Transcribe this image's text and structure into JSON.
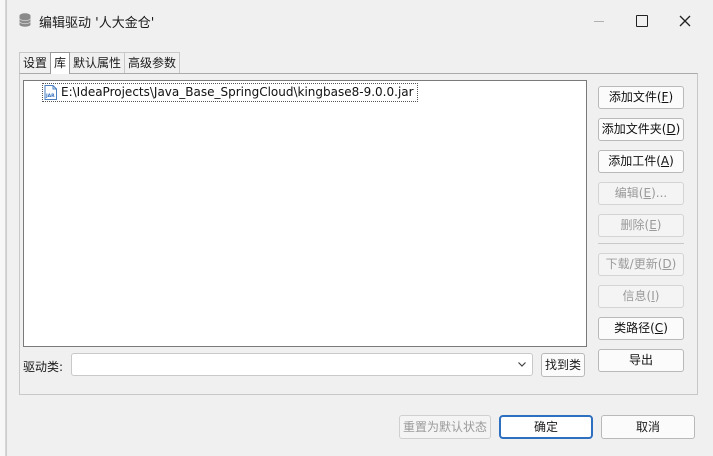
{
  "window": {
    "title": "编辑驱动 '人大金仓'"
  },
  "tabs": [
    {
      "label": "设置"
    },
    {
      "label": "库"
    },
    {
      "label": "默认属性"
    },
    {
      "label": "高级参数"
    }
  ],
  "libraries": {
    "items": [
      {
        "path": "E:\\IdeaProjects\\Java_Base_SpringCloud\\kingbase8-9.0.0.jar",
        "icon": "jar-icon"
      }
    ]
  },
  "side_buttons": {
    "add_file": {
      "label": "添加文件(",
      "mnemonic": "F",
      "suffix": ")"
    },
    "add_folder": {
      "label": "添加文件夹(",
      "mnemonic": "D",
      "suffix": ")"
    },
    "add_artifact": {
      "label": "添加工件(",
      "mnemonic": "A",
      "suffix": ")"
    },
    "edit": {
      "label": "编辑(",
      "mnemonic": "E",
      "suffix": ")..."
    },
    "delete": {
      "label": "删除(",
      "mnemonic": "E",
      "suffix": ")"
    },
    "download": {
      "label": "下载/更新(",
      "mnemonic": "D",
      "suffix": ")"
    },
    "info": {
      "label": "信息(",
      "mnemonic": "I",
      "suffix": ")"
    },
    "classpath": {
      "label": "类路径(",
      "mnemonic": "C",
      "suffix": ")"
    },
    "export": {
      "label": "导出"
    }
  },
  "driver_class": {
    "label": "驱动类:",
    "value": "",
    "find_label": "找到类"
  },
  "footer": {
    "reset_label": "重置为默认状态",
    "ok_label": "确定",
    "cancel_label": "取消"
  },
  "colors": {
    "accent": "#2f6fbf",
    "disabled_text": "#9a9a9a"
  }
}
